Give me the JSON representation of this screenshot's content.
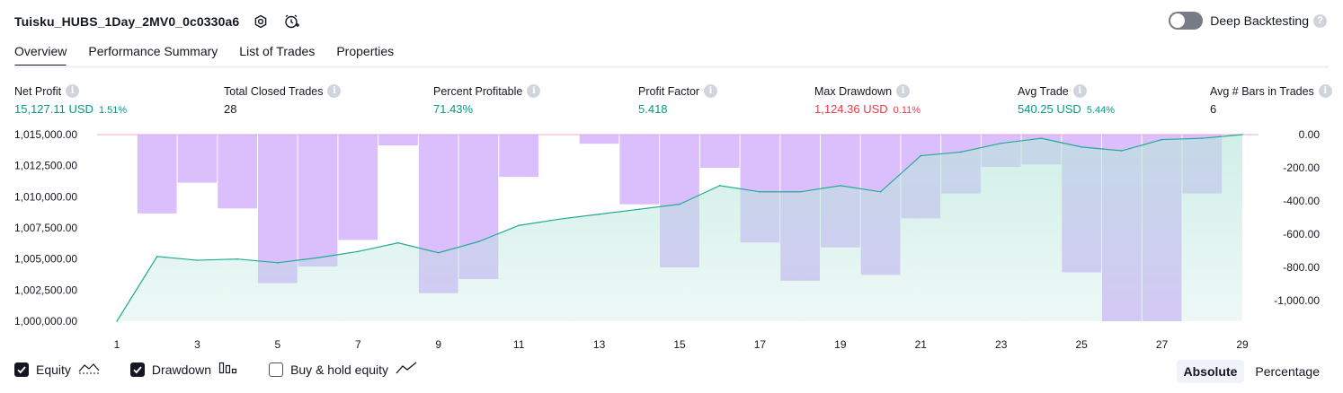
{
  "header": {
    "title": "Tuisku_HUBS_1Day_2MV0_0c0330a6",
    "deep_backtesting_label": "Deep Backtesting",
    "deep_backtesting_on": false
  },
  "tabs": [
    "Overview",
    "Performance Summary",
    "List of Trades",
    "Properties"
  ],
  "active_tab": "Overview",
  "metrics": {
    "net_profit": {
      "label": "Net Profit",
      "value": "15,127.11 USD",
      "pct": "1.51%"
    },
    "total_closed_trades": {
      "label": "Total Closed Trades",
      "value": "28"
    },
    "percent_profitable": {
      "label": "Percent Profitable",
      "value": "71.43%"
    },
    "profit_factor": {
      "label": "Profit Factor",
      "value": "5.418"
    },
    "max_drawdown": {
      "label": "Max Drawdown",
      "value": "1,124.36 USD",
      "pct": "0.11%"
    },
    "avg_trade": {
      "label": "Avg Trade",
      "value": "540.25 USD",
      "pct": "5.44%"
    },
    "avg_bars": {
      "label": "Avg # Bars in Trades",
      "value": "6"
    }
  },
  "legend": {
    "equity": "Equity",
    "drawdown": "Drawdown",
    "buy_hold": "Buy & hold equity",
    "equity_checked": true,
    "drawdown_checked": true,
    "buy_hold_checked": false
  },
  "modes": {
    "absolute": "Absolute",
    "percentage": "Percentage",
    "active": "Absolute"
  },
  "colors": {
    "equity_line": "#22ab94",
    "equity_fill": "#b9e6dc",
    "drawdown_fill": "#c89dfb",
    "positive": "#089981",
    "negative": "#f23645",
    "zero_line": "#f7a8c0"
  },
  "chart_data": {
    "type": "area",
    "x": [
      1,
      2,
      3,
      4,
      5,
      6,
      7,
      8,
      9,
      10,
      11,
      12,
      13,
      14,
      15,
      16,
      17,
      18,
      19,
      20,
      21,
      22,
      23,
      24,
      25,
      26,
      27,
      28,
      29
    ],
    "x_ticks": [
      1,
      3,
      5,
      7,
      9,
      11,
      13,
      15,
      17,
      19,
      21,
      23,
      25,
      27,
      29
    ],
    "left_axis": {
      "ylim": [
        1000000,
        1015000
      ],
      "ticks": [
        1000000,
        1002500,
        1005000,
        1007500,
        1010000,
        1012500,
        1015000
      ],
      "tick_labels": [
        "1,000,000.00",
        "1,002,500.00",
        "1,005,000.00",
        "1,007,500.00",
        "1,010,000.00",
        "1,012,500.00",
        "1,015,000.00"
      ]
    },
    "right_axis": {
      "ylim": [
        -1124.36,
        0
      ],
      "ticks": [
        0,
        -200,
        -400,
        -600,
        -800,
        -1000
      ],
      "tick_labels": [
        "0.00",
        "-200.00",
        "-400.00",
        "-600.00",
        "-800.00",
        "-1,000.00"
      ]
    },
    "series": [
      {
        "name": "Equity",
        "type": "area",
        "axis": "left",
        "values": [
          1000000,
          1005200,
          1004900,
          1005000,
          1004700,
          1005100,
          1005600,
          1006300,
          1005500,
          1006400,
          1007700,
          1008200,
          1008600,
          1009000,
          1009400,
          1010900,
          1010400,
          1010400,
          1010900,
          1010400,
          1013300,
          1013600,
          1014300,
          1014700,
          1014000,
          1013700,
          1014600,
          1014700,
          1015000
        ]
      },
      {
        "name": "Drawdown",
        "type": "bar",
        "axis": "right",
        "values": [
          0,
          -475,
          -290,
          -445,
          -895,
          -795,
          -635,
          -65,
          -955,
          -870,
          -255,
          0,
          -55,
          -420,
          -800,
          -200,
          -650,
          -880,
          -680,
          -845,
          -505,
          -355,
          -195,
          -180,
          -830,
          -1124.36,
          -1124.36,
          -355,
          0
        ]
      }
    ]
  }
}
